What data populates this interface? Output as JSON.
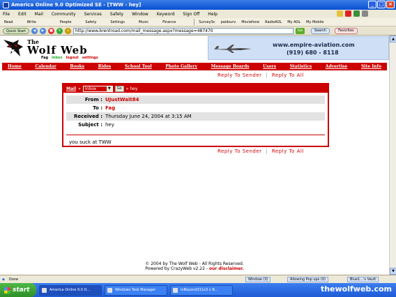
{
  "window": {
    "title": "America Online 9.0 Optimized SE - [TWW - hey]",
    "controls": {
      "minimize": "_",
      "maximize": "□",
      "close": "×"
    }
  },
  "menubar": [
    "File",
    "Edit",
    "Mail",
    "Community",
    "Services",
    "Safety",
    "Window",
    "Keyword",
    "Sign Off",
    "Help"
  ],
  "toolbar": {
    "items": [
      "Read",
      "Write",
      "People",
      "Safety",
      "Settings",
      "Music",
      "Finance",
      "SurveySc",
      "paidsurv",
      "Moviefone",
      "RadioAOL",
      "My AOL",
      "My Mobile"
    ]
  },
  "addressbar": {
    "quick_start": "Quick Start",
    "url": "http://www.brentroad.com/mail_message.aspx?message=487470",
    "go": "Go",
    "search": "Search",
    "favorites": "Favorites"
  },
  "site": {
    "name_small": "The",
    "name_big": "Wolf Web",
    "top_links": {
      "fag": "Fag",
      "inbox": "inbox",
      "logout": "logout",
      "settings": "settings"
    },
    "ad": {
      "url": "www.empire-aviation.com",
      "phone": "(919) 680 - 8118"
    },
    "nav": [
      "Home",
      "Calendar",
      "Books",
      "Rides",
      "School Tool",
      "Photo Gallery",
      "Message Boards",
      "Users",
      "Statistics",
      "Advertise",
      "Site Info"
    ],
    "reply_to_sender": "Reply To Sender",
    "reply_to_all": "Reply To All",
    "reply_separator": "|"
  },
  "message": {
    "header": {
      "mail": "Mail",
      "arrow": "»",
      "folder": "Inbox",
      "go": "Go",
      "subject_crumb": "» hey"
    },
    "fields": [
      {
        "label": "From :",
        "value": "UJustWait84",
        "is_link": true
      },
      {
        "label": "To :",
        "value": "Fag",
        "is_link": true
      },
      {
        "label": "Received :",
        "value": "Thursday June 24, 2004 at 3:15 AM",
        "is_link": false
      },
      {
        "label": "Subject :",
        "value": "hey",
        "is_link": false
      }
    ],
    "body": "you suck at TWW"
  },
  "footer": {
    "copyright": "© 2004 by The Wolf Web - All Rights Reserved.",
    "powered": "Powered by CrazyWeb v2.22 -",
    "disclaimer": "our disclaimer."
  },
  "statusbar": {
    "done": "Done",
    "window": "Window (3)",
    "popup": "Allowing Pop ups (0)",
    "vault": "Blue1...'s Vault"
  },
  "taskbar": {
    "start": "start",
    "tasks": [
      "America Online 9.0 O...",
      "Windows Task Manager",
      "InBeyond311x3 x B..."
    ],
    "watermark": "thewolfweb.com"
  },
  "colors": {
    "brand_red": "#cc0000",
    "xp_blue": "#1f5bd6",
    "aol_panel": "#ece9d8"
  },
  "icons": [
    "window-icon",
    "wolf-logo-icon",
    "airplane-icon",
    "back-icon",
    "forward-icon",
    "start-flag-icon"
  ]
}
